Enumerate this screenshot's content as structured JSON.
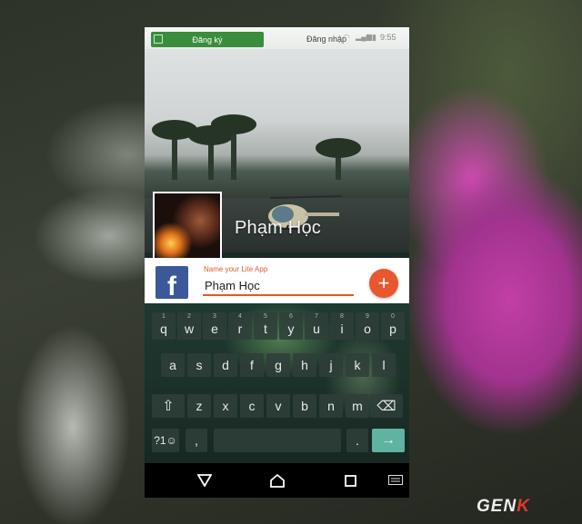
{
  "status_bar": {
    "green_button_label": "Đăng ký",
    "notification_text": "Đăng nhập",
    "time": "9:55"
  },
  "cover": {
    "profile_name": "Phạm Học"
  },
  "form": {
    "label": "Name your Lite App",
    "value": "Phạm Học",
    "add_button": "+"
  },
  "keyboard": {
    "row1": [
      {
        "key": "q",
        "hint": "1"
      },
      {
        "key": "w",
        "hint": "2"
      },
      {
        "key": "e",
        "hint": "3"
      },
      {
        "key": "r",
        "hint": "4"
      },
      {
        "key": "t",
        "hint": "5"
      },
      {
        "key": "y",
        "hint": "6"
      },
      {
        "key": "u",
        "hint": "7"
      },
      {
        "key": "i",
        "hint": "8"
      },
      {
        "key": "o",
        "hint": "9"
      },
      {
        "key": "p",
        "hint": "0"
      }
    ],
    "row2": [
      "a",
      "s",
      "d",
      "f",
      "g",
      "h",
      "j",
      "k",
      "l"
    ],
    "row3": [
      "z",
      "x",
      "c",
      "v",
      "b",
      "n",
      "m"
    ],
    "symbols_key": "?1☺",
    "comma_key": ",",
    "period_key": ".",
    "shift_icon": "shift-arrow",
    "backspace_icon": "backspace",
    "enter_icon": "arrow-right"
  },
  "nav": {
    "back": "back-triangle",
    "home": "home-house",
    "recents": "recents-square",
    "keyboard": "keyboard-switch"
  },
  "watermark": {
    "text": "GEN",
    "accent": "K"
  },
  "colors": {
    "accent": "#e9572e",
    "facebook": "#3b5998",
    "green": "#3a8d3a"
  }
}
